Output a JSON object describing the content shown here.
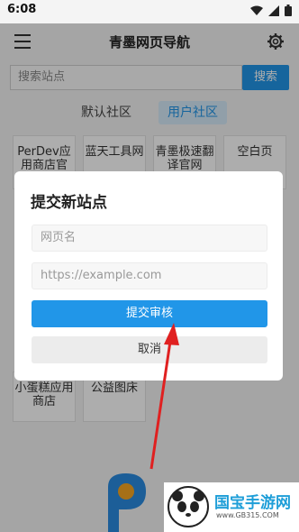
{
  "status": {
    "time": "6:08"
  },
  "app": {
    "title": "青墨网页导航"
  },
  "search": {
    "placeholder": "搜索站点",
    "button": "搜索"
  },
  "tabs": [
    {
      "label": "默认社区"
    },
    {
      "label": "用户社区"
    }
  ],
  "cards_top": [
    {
      "label": "PerDev应用商店官"
    },
    {
      "label": "蓝天工具网"
    },
    {
      "label": "青墨极速翻译官网"
    },
    {
      "label": "空白页"
    }
  ],
  "cards_bottom": [
    {
      "label": "小蛋糕应用商店"
    },
    {
      "label": "公益图床"
    }
  ],
  "dialog": {
    "title": "提交新站点",
    "name_placeholder": "网页名",
    "url_placeholder": "https://example.com",
    "submit": "提交审核",
    "cancel": "取消"
  },
  "watermark": {
    "text": "国宝手游网",
    "url": "www.GB315.COM"
  },
  "colors": {
    "accent": "#2196e8",
    "arrow": "#e02020"
  }
}
